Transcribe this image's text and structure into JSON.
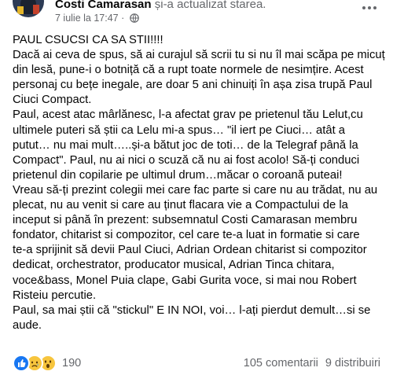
{
  "post": {
    "author": "Costi Camarasan",
    "action": "și-a actualizat starea.",
    "timestamp": "7 iulie la 17:47",
    "privacy_icon": "globe-icon",
    "more_icon": "more-options-icon",
    "text_lines": [
      "PAUL CSUCSI CA SA STII!!!!",
      "Dacă ai ceva de spus, să ai curajul să scrii tu si nu îl mai scăpa pe micuț",
      "din lesă, pune-i o botniță că a rupt toate normele de nesimțire. Acest",
      "personaj cu bețe inegale, are doar 5 ani chinuiți în așa zisa trupă Paul",
      "Ciuci Compact.",
      "Paul, acest atac mârlănesc, l-a afectat grav pe prietenul tău Lelut,cu",
      "ultimele puteri să știi ca Lelu mi-a spus… \"il iert pe Ciuci… atât a",
      "putut… nu mai mult…..și-a bătut joc de toti… de la Telegraf până la",
      "Compact\". Paul, nu ai nici o scuză că nu ai fost acolo! Să-ți conduci",
      "prietenul din copilarie pe ultimul drum…măcar o coroană puteai!",
      "Vreau să-ți prezint colegii mei care fac parte si care nu au trădat, nu au",
      "plecat, nu au venit si care au ținut flacara vie a Compactului de la",
      "inceput si până în prezent: subsemnatul Costi Camarasan membru",
      "fondator, chitarist si compozitor, cel care te-a luat in formatie si care",
      "te-a sprijinit să devii Paul Ciuci, Adrian Ordean chitarist si compozitor",
      "dedicat, orchestrator, producator musical, Adrian Tinca chitara,",
      "voce&bass, Monel Puia clape, Gabi Gurita voce, si mai nou Robert",
      "Risteiu percutie.",
      "Paul, sa mai știi că \"stickul\" E IN NOI, voi… l-ați pierdut demult…si se",
      "aude."
    ]
  },
  "footer": {
    "reactions": [
      "like-icon",
      "sad-icon",
      "wow-icon"
    ],
    "reaction_count": "190",
    "comments": "105 comentarii",
    "shares": "9 distribuiri"
  },
  "colors": {
    "like_blue": "#1877f2",
    "secondary_text": "#65676b",
    "primary_text": "#050505"
  }
}
